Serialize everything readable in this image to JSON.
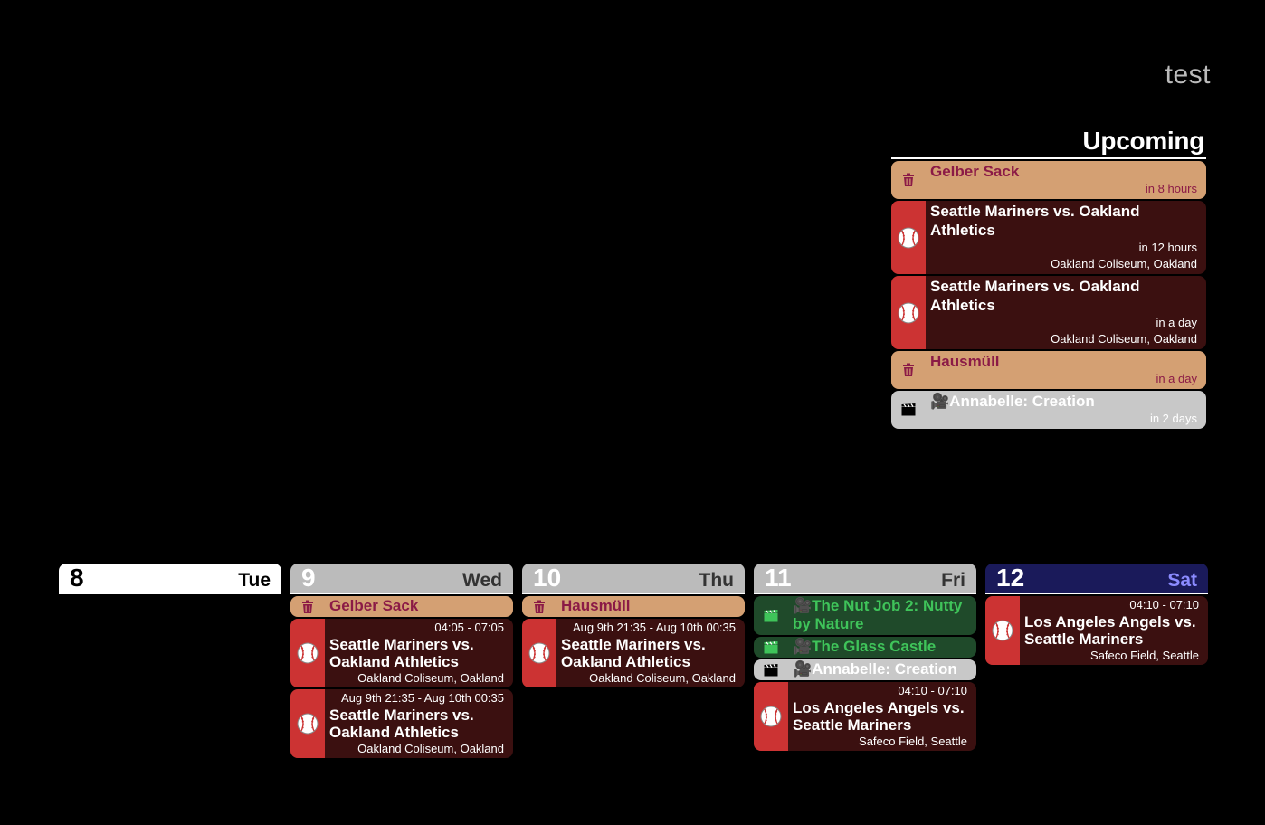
{
  "header": {
    "title": "test"
  },
  "upcoming": {
    "title": "Upcoming",
    "events": [
      {
        "kind": "trash",
        "icon": "trash-icon",
        "title": "Gelber Sack",
        "relative": "in 8 hours",
        "location": ""
      },
      {
        "kind": "baseball",
        "icon": "baseball-icon",
        "title": "Seattle Mariners vs. Oakland Athletics",
        "relative": "in 12 hours",
        "location": "Oakland Coliseum, Oakland"
      },
      {
        "kind": "baseball",
        "icon": "baseball-icon",
        "title": "Seattle Mariners vs. Oakland Athletics",
        "relative": "in a day",
        "location": "Oakland Coliseum, Oakland"
      },
      {
        "kind": "trash",
        "icon": "trash-icon",
        "title": "Hausmüll",
        "relative": "in a day",
        "location": ""
      },
      {
        "kind": "movie",
        "icon": "clapperboard-icon",
        "title": "🎥Annabelle: Creation",
        "relative": "in 2 days",
        "location": ""
      }
    ]
  },
  "week": [
    {
      "num": "8",
      "weekday": "Tue",
      "style": "white",
      "events": []
    },
    {
      "num": "9",
      "weekday": "Wed",
      "style": "grey",
      "events": [
        {
          "kind": "trash",
          "title": "Gelber Sack"
        },
        {
          "kind": "baseball",
          "time": "04:05 - 07:05",
          "title": "Seattle Mariners vs. Oakland Athletics",
          "location": "Oakland Coliseum, Oakland"
        },
        {
          "kind": "baseball",
          "time": "Aug 9th 21:35 - Aug 10th 00:35",
          "title": "Seattle Mariners vs. Oakland Athletics",
          "location": "Oakland Coliseum, Oakland"
        }
      ]
    },
    {
      "num": "10",
      "weekday": "Thu",
      "style": "grey",
      "events": [
        {
          "kind": "trash",
          "title": "Hausmüll"
        },
        {
          "kind": "baseball",
          "time": "Aug 9th 21:35 - Aug 10th 00:35",
          "title": "Seattle Mariners vs. Oakland Athletics",
          "location": "Oakland Coliseum, Oakland"
        }
      ]
    },
    {
      "num": "11",
      "weekday": "Fri",
      "style": "grey",
      "events": [
        {
          "kind": "movie-green",
          "title": "🎥The Nut Job 2: Nutty by Nature"
        },
        {
          "kind": "movie-green",
          "title": "🎥The Glass Castle"
        },
        {
          "kind": "movie",
          "title": "🎥Annabelle: Creation"
        },
        {
          "kind": "baseball",
          "time": "04:10 - 07:10",
          "title": "Los Angeles Angels vs. Seattle Mariners",
          "location": "Safeco Field, Seattle"
        }
      ]
    },
    {
      "num": "12",
      "weekday": "Sat",
      "style": "navy",
      "events": [
        {
          "kind": "baseball",
          "time": "04:10 - 07:10",
          "title": "Los Angeles Angels vs. Seattle Mariners",
          "location": "Safeco Field, Seattle"
        }
      ]
    }
  ],
  "colors": {
    "trash_bg": "#d4a073",
    "trash_fg": "#8b1a46",
    "baseball_bg": "#3b1010",
    "baseball_accent": "#cc3333",
    "movie_bg": "#c8c8c8",
    "movie_green_bg": "#1f4a2a",
    "movie_green_fg": "#3fc45a"
  }
}
